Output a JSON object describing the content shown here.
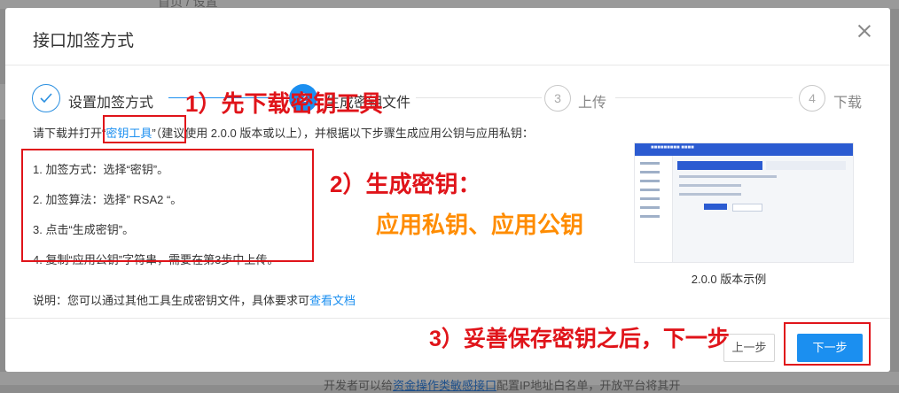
{
  "background": {
    "breadcrumb": "首页 / 设置",
    "bottom_text_prefix": "开发者可以给",
    "bottom_link": "资金操作类敏感接口",
    "bottom_text_suffix": "配置IP地址白名单，开放平台将其开"
  },
  "dialog": {
    "title": "接口加签方式",
    "close_label": "×"
  },
  "steps": [
    {
      "number": "1",
      "label": "设置加签方式",
      "state": "done"
    },
    {
      "number": "2",
      "label": "生成密钥文件",
      "state": "active"
    },
    {
      "number": "3",
      "label": "上传",
      "state": "wait"
    },
    {
      "number": "4",
      "label": "下载",
      "state": "wait"
    }
  ],
  "intro": {
    "prefix": "请下载并打开“",
    "link": "密钥工具",
    "suffix": "”（建议使用 2.0.0 版本或以上），并根据以下步骤生成应用公钥与应用私钥："
  },
  "instructions": [
    "1. 加签方式：选择“密钥”。",
    "2. 加签算法：选择” RSA2 “。",
    "3. 点击“生成密钥”。",
    "4. 复制“应用公钥”字符串，需要在第3步中上传。"
  ],
  "example_caption": "2.0.0 版本示例",
  "note": {
    "prefix": "说明：您可以通过其他工具生成密钥文件，具体要求可",
    "link": "查看文档"
  },
  "annotations": {
    "a1": "1）先下载密钥工具",
    "a2": "2）生成密钥：",
    "a3": "应用私钥、应用公钥",
    "a4": "3）妥善保存密钥之后，下一步"
  },
  "buttons": {
    "prev": "上一步",
    "next": "下一步"
  },
  "colors": {
    "primary": "#1b8ff0",
    "annotation_red": "#e0141a",
    "annotation_orange": "#ff8c00"
  }
}
